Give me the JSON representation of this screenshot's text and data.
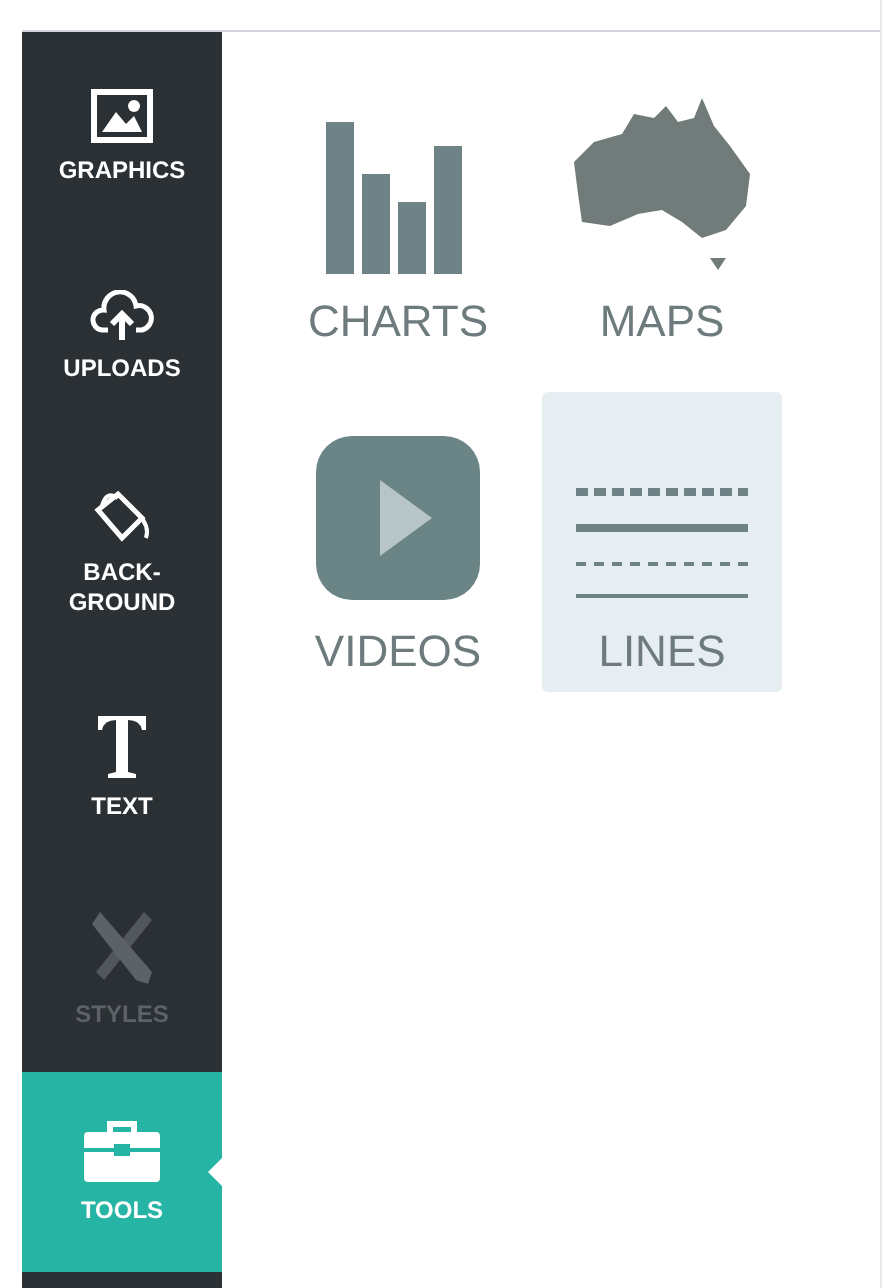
{
  "sidebar": {
    "items": [
      {
        "kind": "graphics",
        "label": "GRAPHICS",
        "selected": false,
        "disabled": false
      },
      {
        "kind": "uploads",
        "label": "UPLOADS",
        "selected": false,
        "disabled": false
      },
      {
        "kind": "background",
        "label": "BACK-\nGROUND",
        "selected": false,
        "disabled": false
      },
      {
        "kind": "text",
        "label": "TEXT",
        "selected": false,
        "disabled": false
      },
      {
        "kind": "styles",
        "label": "STYLES",
        "selected": false,
        "disabled": true
      },
      {
        "kind": "tools",
        "label": "TOOLS",
        "selected": true,
        "disabled": false
      }
    ]
  },
  "panel": {
    "tiles": [
      {
        "kind": "charts",
        "label": "CHARTS",
        "highlighted": false
      },
      {
        "kind": "maps",
        "label": "MAPS",
        "highlighted": false
      },
      {
        "kind": "videos",
        "label": "VIDEOS",
        "highlighted": false
      },
      {
        "kind": "lines",
        "label": "LINES",
        "highlighted": true
      }
    ]
  }
}
